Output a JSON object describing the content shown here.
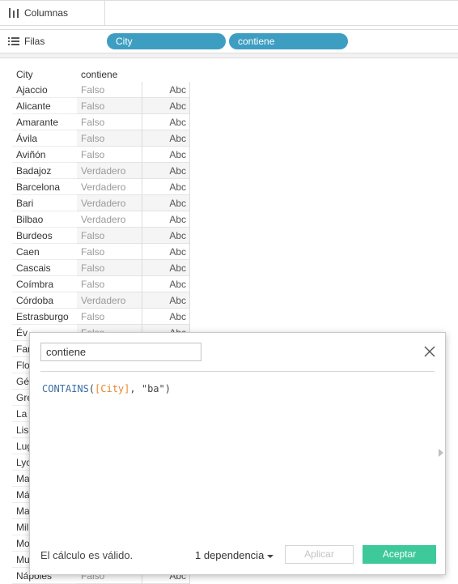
{
  "shelves": {
    "columns_label": "Columnas",
    "rows_label": "Filas",
    "row_pills": [
      "City",
      "contiene"
    ]
  },
  "table": {
    "headers": {
      "city": "City",
      "contiene": "contiene"
    },
    "rows": [
      {
        "city": "Ajaccio",
        "value": "Falso",
        "abc": "Abc"
      },
      {
        "city": "Alicante",
        "value": "Falso",
        "abc": "Abc"
      },
      {
        "city": "Amarante",
        "value": "Falso",
        "abc": "Abc"
      },
      {
        "city": "Ávila",
        "value": "Falso",
        "abc": "Abc"
      },
      {
        "city": "Aviñón",
        "value": "Falso",
        "abc": "Abc"
      },
      {
        "city": "Badajoz",
        "value": "Verdadero",
        "abc": "Abc"
      },
      {
        "city": "Barcelona",
        "value": "Verdadero",
        "abc": "Abc"
      },
      {
        "city": "Bari",
        "value": "Verdadero",
        "abc": "Abc"
      },
      {
        "city": "Bilbao",
        "value": "Verdadero",
        "abc": "Abc"
      },
      {
        "city": "Burdeos",
        "value": "Falso",
        "abc": "Abc"
      },
      {
        "city": "Caen",
        "value": "Falso",
        "abc": "Abc"
      },
      {
        "city": "Cascais",
        "value": "Falso",
        "abc": "Abc"
      },
      {
        "city": "Coímbra",
        "value": "Falso",
        "abc": "Abc"
      },
      {
        "city": "Córdoba",
        "value": "Verdadero",
        "abc": "Abc"
      },
      {
        "city": "Estrasburgo",
        "value": "Falso",
        "abc": "Abc"
      },
      {
        "city": "Év",
        "value": "Falso",
        "abc": "Abc"
      },
      {
        "city": "Far",
        "value": "",
        "abc": ""
      },
      {
        "city": "Flo",
        "value": "",
        "abc": ""
      },
      {
        "city": "Gé",
        "value": "",
        "abc": ""
      },
      {
        "city": "Gre",
        "value": "",
        "abc": ""
      },
      {
        "city": "La",
        "value": "",
        "abc": ""
      },
      {
        "city": "Lis",
        "value": "",
        "abc": ""
      },
      {
        "city": "Lug",
        "value": "",
        "abc": ""
      },
      {
        "city": "Lyo",
        "value": "",
        "abc": ""
      },
      {
        "city": "Ma",
        "value": "",
        "abc": ""
      },
      {
        "city": "Má",
        "value": "",
        "abc": ""
      },
      {
        "city": "Ma",
        "value": "",
        "abc": ""
      },
      {
        "city": "Mil",
        "value": "",
        "abc": ""
      },
      {
        "city": "Mo",
        "value": "",
        "abc": ""
      },
      {
        "city": "Mu",
        "value": "",
        "abc": ""
      },
      {
        "city": "Nápoles",
        "value": "Falso",
        "abc": "Abc"
      }
    ]
  },
  "dialog": {
    "name_value": "contiene",
    "formula": {
      "func": "CONTAINS",
      "open": "(",
      "field": "[City]",
      "sep": ", ",
      "string": "\"ba\"",
      "close": ")"
    },
    "status": "El cálculo es válido.",
    "dependencies": "1 dependencia",
    "apply_label": "Aplicar",
    "ok_label": "Aceptar"
  },
  "colors": {
    "pill": "#3e9ec1",
    "ok_button": "#3ec99a",
    "formula_func": "#3a6ea5",
    "formula_field": "#e8872c"
  },
  "icons": {
    "columns": "columns-icon",
    "rows": "rows-icon",
    "close": "close-icon"
  }
}
